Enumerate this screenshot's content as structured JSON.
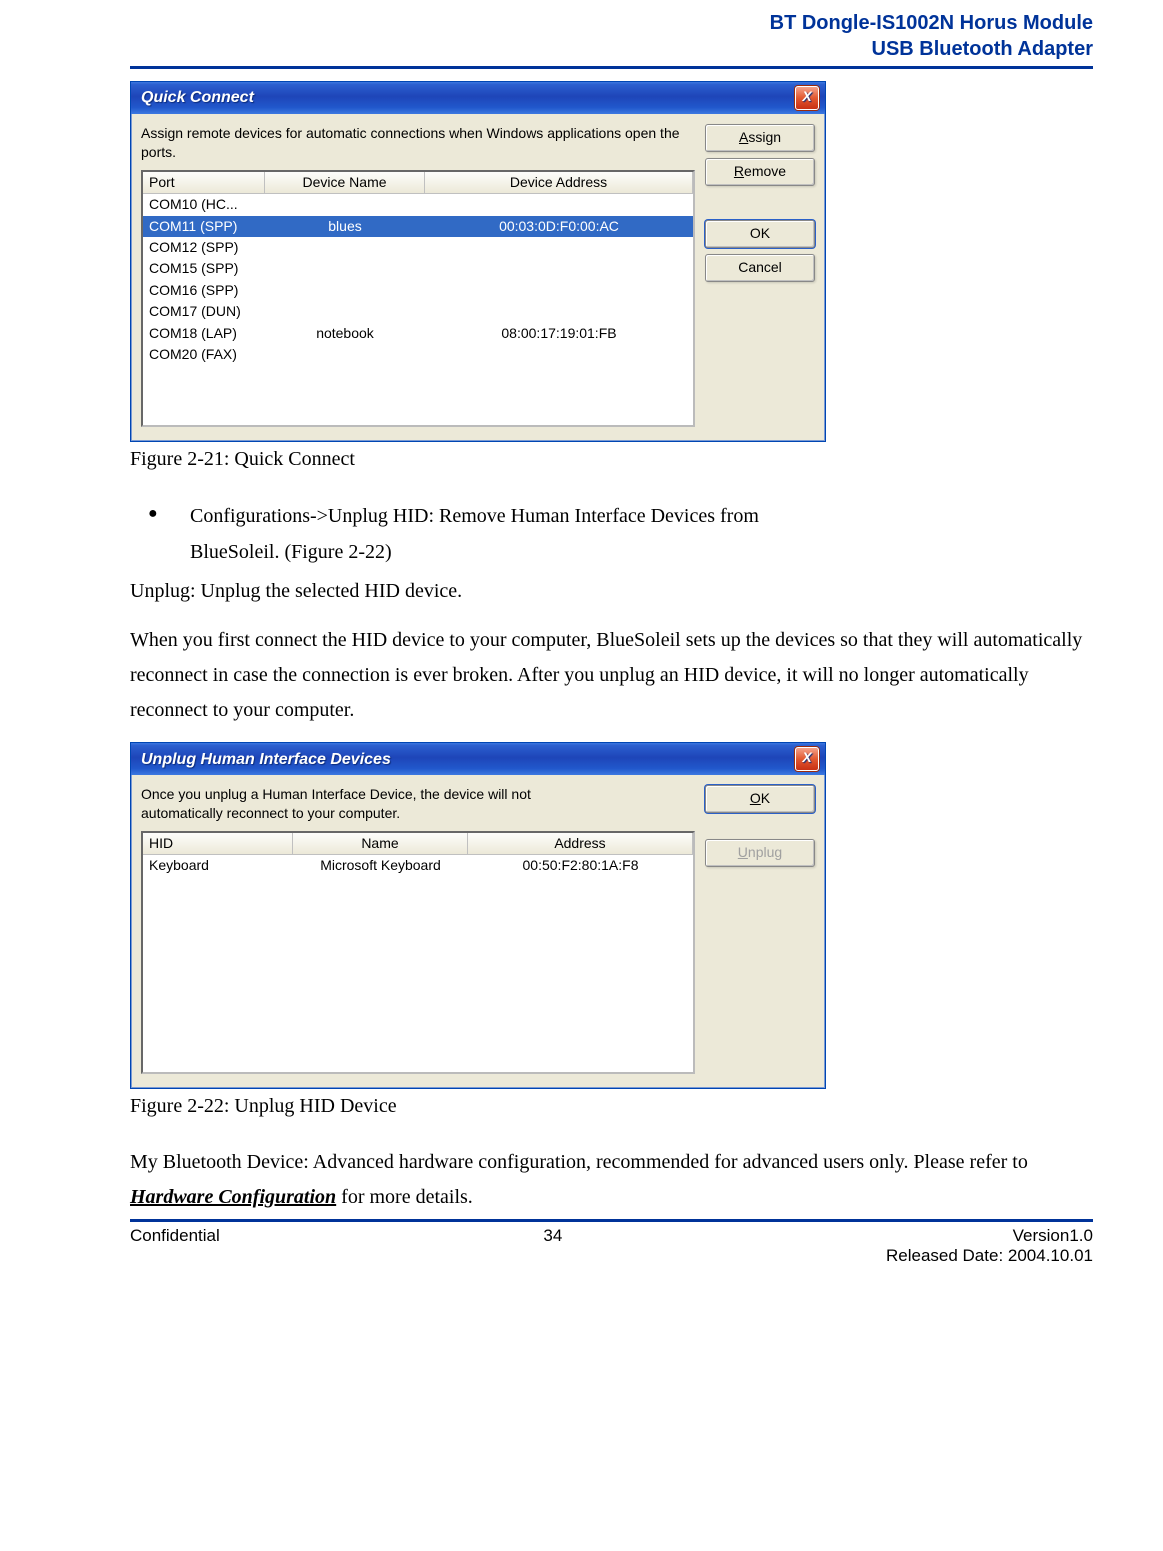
{
  "header": {
    "line1": "BT Dongle-IS1002N Horus Module",
    "line2": "USB Bluetooth Adapter"
  },
  "dialog1": {
    "title": "Quick Connect",
    "close": "X",
    "instruction": "Assign remote devices for automatic connections when Windows applications open the ports.",
    "columns": {
      "c1": "Port",
      "c2": "Device Name",
      "c3": "Device Address"
    },
    "rows": [
      {
        "c1": "COM10 (HC...",
        "c2": "",
        "c3": "",
        "selected": false
      },
      {
        "c1": "COM11 (SPP)",
        "c2": "blues",
        "c3": "00:03:0D:F0:00:AC",
        "selected": true
      },
      {
        "c1": "COM12 (SPP)",
        "c2": "",
        "c3": "",
        "selected": false
      },
      {
        "c1": "COM15 (SPP)",
        "c2": "",
        "c3": "",
        "selected": false
      },
      {
        "c1": "COM16 (SPP)",
        "c2": "",
        "c3": "",
        "selected": false
      },
      {
        "c1": "COM17 (DUN)",
        "c2": "",
        "c3": "",
        "selected": false
      },
      {
        "c1": "COM18 (LAP)",
        "c2": "notebook",
        "c3": "08:00:17:19:01:FB",
        "selected": false
      },
      {
        "c1": "COM20 (FAX)",
        "c2": "",
        "c3": "",
        "selected": false
      }
    ],
    "buttons": {
      "assign_pre": "A",
      "assign_post": "ssign",
      "remove_pre": "R",
      "remove_post": "emove",
      "ok": "OK",
      "cancel": "Cancel"
    }
  },
  "caption1": "Figure 2-21: Quick Connect",
  "bullet": {
    "line1": "Configurations->Unplug HID: Remove Human Interface Devices from",
    "line2": "BlueSoleil. (Figure 2-22)"
  },
  "para_unplug": "Unplug: Unplug the selected HID device.",
  "para_long": "When you first connect the HID device to your computer, BlueSoleil sets up the devices so that they will automatically reconnect in case the connection is ever broken. After you unplug an HID device, it will no longer automatically reconnect to your computer.",
  "dialog2": {
    "title": "Unplug Human Interface Devices",
    "close": "X",
    "instruction": "Once you unplug a Human Interface Device, the device will not automatically reconnect to your computer.",
    "columns": {
      "c1": "HID",
      "c2": "Name",
      "c3": "Address"
    },
    "rows": [
      {
        "c1": "Keyboard",
        "c2": "Microsoft Keyboard",
        "c3": "00:50:F2:80:1A:F8",
        "selected": false
      }
    ],
    "buttons": {
      "ok_pre": "O",
      "ok_post": "K",
      "unplug_pre": "U",
      "unplug_post": "nplug"
    }
  },
  "caption2": "Figure 2-22: Unplug HID Device",
  "para_bottom_pre": "My Bluetooth Device: Advanced hardware configuration, recommended for advanced users only. Please refer to ",
  "para_bottom_ref": "Hardware Configuration",
  "para_bottom_post": " for more details.",
  "footer": {
    "left": "Confidential",
    "center": "34",
    "right1": "Version1.0",
    "right2": "Released Date: 2004.10.01"
  }
}
